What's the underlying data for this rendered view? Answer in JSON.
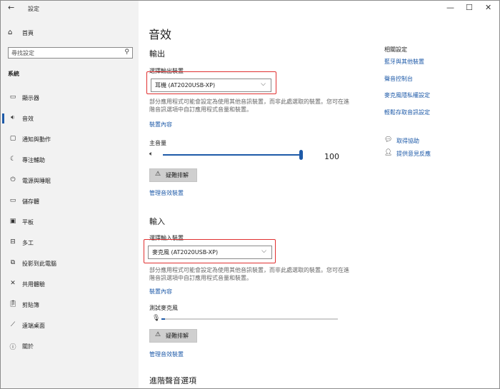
{
  "window": {
    "title": "設定",
    "minimize_label": "—",
    "maximize_label": "☐",
    "close_label": "✕",
    "back_label": "←"
  },
  "sidebar": {
    "home_label": "首頁",
    "search_placeholder": "尋找設定",
    "section_label": "系統",
    "items": [
      {
        "label": "顯示器",
        "icon": "display-icon",
        "glyph": "▭"
      },
      {
        "label": "音效",
        "icon": "sound-icon",
        "glyph": "🔉︎"
      },
      {
        "label": "通知與動作",
        "icon": "notification-icon",
        "glyph": "▢"
      },
      {
        "label": "專注輔助",
        "icon": "moon-icon",
        "glyph": "☾"
      },
      {
        "label": "電源與睡眠",
        "icon": "power-icon",
        "glyph": "⏻"
      },
      {
        "label": "儲存體",
        "icon": "storage-icon",
        "glyph": "▭"
      },
      {
        "label": "平板",
        "icon": "tablet-icon",
        "glyph": "▣"
      },
      {
        "label": "多工",
        "icon": "multitasking-icon",
        "glyph": "⊟"
      },
      {
        "label": "投影到此電腦",
        "icon": "project-icon",
        "glyph": "⧉"
      },
      {
        "label": "共用體驗",
        "icon": "shared-icon",
        "glyph": "✕"
      },
      {
        "label": "剪貼簿",
        "icon": "clipboard-icon",
        "glyph": "📋︎"
      },
      {
        "label": "遠端桌面",
        "icon": "remote-icon",
        "glyph": "⟋"
      },
      {
        "label": "關於",
        "icon": "info-icon",
        "glyph": "ⓘ"
      }
    ],
    "active_index": 1
  },
  "main": {
    "title": "音效",
    "output": {
      "heading": "輸出",
      "device_label": "選擇輸出裝置",
      "device_value": "耳機 (AT2020USB-XP)",
      "description": "部分應用程式可能會設定為使用其他音訊裝置，而非此處選取的裝置。您可在進階音訊選項中自訂應用程式音量和裝置。",
      "properties_link": "裝置內容",
      "volume_label": "主音量",
      "volume_value": "100",
      "volume_level": 1.0,
      "troubleshoot_label": "疑難排解",
      "manage_link": "管理音效裝置"
    },
    "input": {
      "heading": "輸入",
      "device_label": "選擇輸入裝置",
      "device_value": "麥克風 (AT2020USB-XP)",
      "description": "部分應用程式可能會設定為使用其他音訊裝置，而非此處選取的裝置。您可在進階音訊選項中自訂應用程式音量和裝置。",
      "properties_link": "裝置內容",
      "test_label": "測試麥克風",
      "mic_level": 0.02,
      "troubleshoot_label": "疑難排解",
      "manage_link": "管理音效裝置"
    },
    "advanced_heading": "進階聲音選項"
  },
  "related": {
    "title": "相關設定",
    "links": [
      "藍牙與其他裝置",
      "聲音控制台",
      "麥克風隱私權設定",
      "輕鬆存取音訊設定"
    ],
    "help_label": "取得協助",
    "feedback_label": "提供意見反應"
  },
  "colors": {
    "accent": "#1e5aa8",
    "highlight_box": "#e03030"
  }
}
